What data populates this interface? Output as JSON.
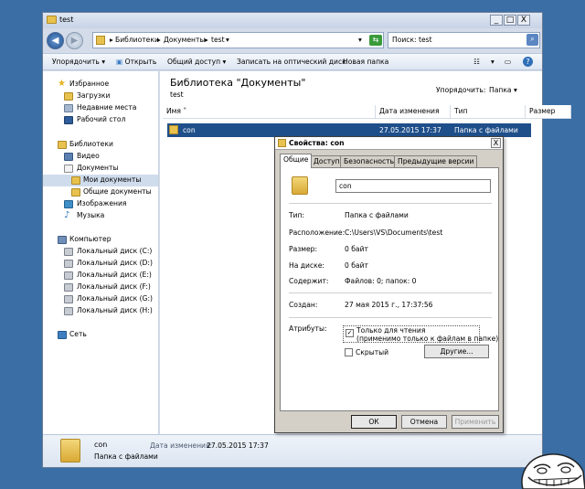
{
  "window": {
    "title": "test",
    "minimize": "_",
    "maximize": "□",
    "close": "X"
  },
  "address": {
    "crumbs": [
      "Библиотеки",
      "Документы",
      "test"
    ],
    "search_placeholder": "Поиск: test"
  },
  "toolbar": {
    "organize": "Упорядочить",
    "open": "Открыть",
    "share": "Общий доступ",
    "burn": "Записать на оптический диск",
    "new_folder": "Новая папка"
  },
  "nav": {
    "favorites": "Избранное",
    "downloads": "Загрузки",
    "recent": "Недавние места",
    "desktop": "Рабочий стол",
    "libraries": "Библиотеки",
    "video": "Видео",
    "documents": "Документы",
    "my_documents": "Мои документы",
    "public_documents": "Общие документы",
    "images": "Изображения",
    "music": "Музыка",
    "computer": "Компьютер",
    "drives": [
      "Локальный диск (C:)",
      "Локальный диск (D:)",
      "Локальный диск (E:)",
      "Локальный диск (F:)",
      "Локальный диск (G:)",
      "Локальный диск (H:)"
    ],
    "network": "Сеть"
  },
  "content": {
    "library_title": "Библиотека \"Документы\"",
    "library_sub": "test",
    "arrange_label": "Упорядочить:",
    "arrange_value": "Папка",
    "columns": {
      "name": "Имя",
      "date": "Дата изменения",
      "type": "Тип",
      "size": "Размер"
    },
    "file": {
      "name": "con",
      "date": "27.05.2015 17:37",
      "type": "Папка с файлами"
    }
  },
  "details": {
    "name": "con",
    "date_label": "Дата изменения:",
    "date_value": "27.05.2015 17:37",
    "type": "Папка с файлами"
  },
  "dialog": {
    "title": "Свойства: con",
    "close": "X",
    "tabs": [
      "Общие",
      "Доступ",
      "Безопасность",
      "Предыдущие версии"
    ],
    "name_value": "con",
    "props": {
      "type_label": "Тип:",
      "type_value": "Папка с файлами",
      "location_label": "Расположение:",
      "location_value": "C:\\Users\\VS\\Documents\\test",
      "size_label": "Размер:",
      "size_value": "0 байт",
      "disk_label": "На диске:",
      "disk_value": "0 байт",
      "contains_label": "Содержит:",
      "contains_value": "Файлов: 0; папок: 0",
      "created_label": "Создан:",
      "created_value": "27 мая 2015 г., 17:37:56",
      "attrs_label": "Атрибуты:",
      "readonly_line1": "Только для чтения",
      "readonly_line2": "(применимо только к файлам в папке)",
      "hidden": "Скрытый",
      "other_button": "Другие..."
    },
    "ok": "ОК",
    "cancel": "Отмена",
    "apply": "Применить"
  }
}
